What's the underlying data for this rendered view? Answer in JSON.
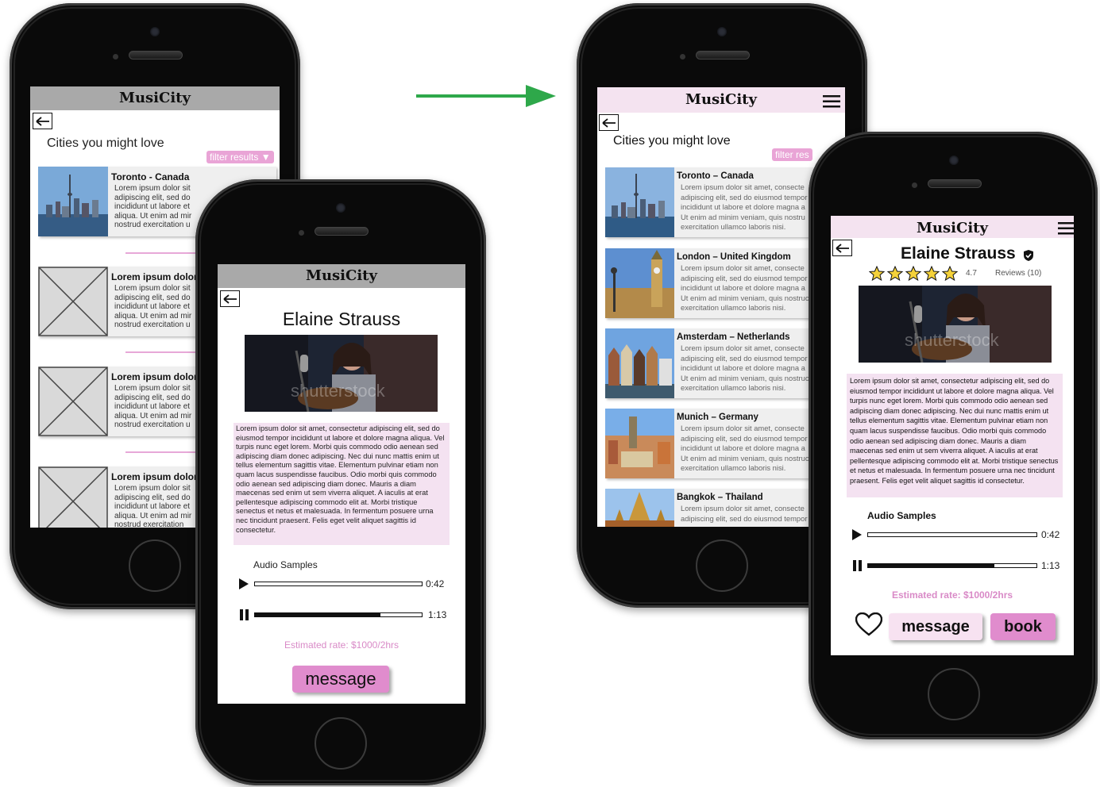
{
  "app_name": "MusiCity",
  "list_screen": {
    "heading": "Cities you might love",
    "filter_label": "filter results",
    "filter_label_short": "filter res",
    "cards_v1": [
      {
        "title": "Toronto - Canada",
        "body": "Lorem ipsum dolor sit\nadipiscing elit, sed do\nincididunt ut labore et\naliqua. Ut enim ad mir\nnostrud exercitation u"
      },
      {
        "title": "Lorem ipsum dolor",
        "body": "Lorem ipsum dolor sit\nadipiscing elit, sed do\nincididunt ut labore et\naliqua. Ut enim ad mir\nnostrud exercitation u"
      },
      {
        "title": "Lorem ipsum dolor",
        "body": "Lorem ipsum dolor sit\nadipiscing elit, sed do\nincididunt ut labore et\naliqua. Ut enim ad mir\nnostrud exercitation u"
      },
      {
        "title": "Lorem ipsum dolor",
        "body": "Lorem ipsum dolor sit\nadipiscing elit, sed do\nincididunt ut labore et\naliqua. Ut enim ad mir\nnostrud exercitation"
      }
    ],
    "cards_v2": [
      {
        "title": "Toronto – Canada",
        "body": "Lorem ipsum dolor sit amet, consecte\nadipiscing elit, sed do eiusmod tempor\nincididunt ut labore et dolore magna a\nUt enim ad minim veniam, quis nostru\nexercitation ullamco laboris nisi."
      },
      {
        "title": "London – United Kingdom",
        "body": "Lorem ipsum dolor sit amet, consecte\nadipiscing elit, sed do eiusmod tempor\nincididunt ut labore et dolore magna a\nUt enim ad minim veniam, quis nostruc\nexercitation ullamco laboris nisi."
      },
      {
        "title": "Amsterdam – Netherlands",
        "body": "Lorem ipsum dolor sit amet, consecte\nadipiscing elit, sed do eiusmod tempor\nincididunt ut labore et dolore magna a\nUt enim ad minim veniam, quis nostruc\nexercitation ullamco laboris nisi."
      },
      {
        "title": "Munich – Germany",
        "body": "Lorem ipsum dolor sit amet, consecte\nadipiscing elit, sed do eiusmod tempor\nincididunt ut labore et dolore magna a\nUt enim ad minim veniam, quis nostruc\nexercitation ullamco laboris nisi."
      },
      {
        "title": "Bangkok – Thailand",
        "body": "Lorem ipsum dolor sit amet, consecte\nadipiscing elit, sed do eiusmod tempor"
      }
    ]
  },
  "profile_screen": {
    "artist_name": "Elaine Strauss",
    "watermark": "shutterstock",
    "rating": "4.7",
    "reviews": "Reviews (10)",
    "bio_v1": "Lorem ipsum dolor sit amet, consectetur adipiscing elit, sed do eiusmod tempor incididunt ut labore et dolore magna aliqua. Vel turpis nunc eget lorem. Morbi quis commodo odio aenean sed adipiscing diam donec adipiscing. Nec dui nunc mattis enim ut tellus elementum sagittis vitae. Elementum pulvinar etiam non quam lacus suspendisse faucibus. Odio morbi quis commodo odio aenean sed adipiscing diam donec. Mauris a diam maecenas sed enim ut sem viverra aliquet. A iaculis at erat pellentesque adipiscing commodo elit at. Morbi tristique senectus et netus et malesuada. In fermentum posuere urna nec tincidunt praesent. Felis eget velit aliquet sagittis id consectetur.",
    "bio_v2": "Lorem ipsum dolor sit amet, consectetur adipiscing elit, sed do eiusmod tempor incididunt ut labore et dolore magna aliqua. Vel turpis nunc eget lorem. Morbi quis commodo odio aenean sed adipiscing diam donec adipiscing. Nec dui nunc mattis enim ut tellus elementum sagittis vitae. Elementum pulvinar etiam non quam lacus suspendisse faucibus. Odio morbi quis commodo odio aenean sed adipiscing diam donec. Mauris a diam maecenas sed enim ut sem viverra aliquet. A iaculis at erat pellentesque adipiscing commodo elit at. Morbi tristique senectus et netus et malesuada. In fermentum posuere urna nec tincidunt praesent. Felis eget velit aliquet sagittis id consectetur.",
    "audio_label": "Audio Samples",
    "tracks": [
      {
        "time": "0:42",
        "progress": 0.0,
        "state": "paused"
      },
      {
        "time": "1:13",
        "progress": 0.75,
        "state": "playing"
      }
    ],
    "rate": "Estimated rate: $1000/2hrs",
    "message_label": "message",
    "book_label": "book"
  },
  "colors": {
    "accent_pink": "#e08ccd",
    "light_pink": "#f4e3f0",
    "arrow_green": "#2ea84a",
    "wireframe_grey": "#a9a9a9"
  }
}
